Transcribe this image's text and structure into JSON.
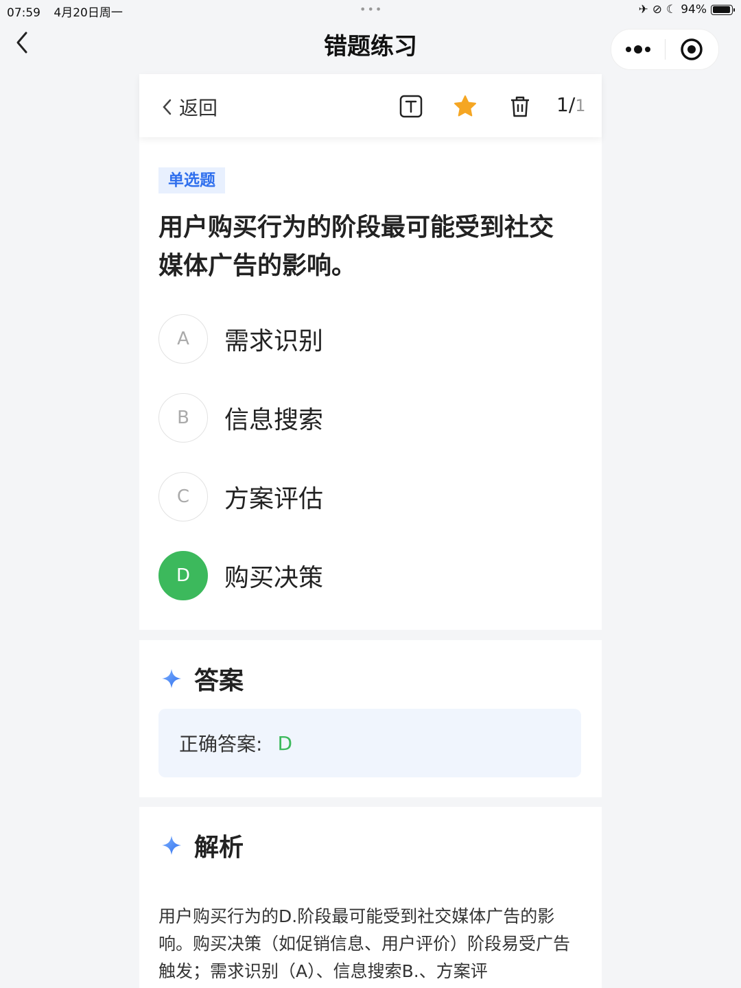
{
  "status": {
    "time": "07:59",
    "date": "4月20日周一",
    "battery": "94%",
    "battery_level": 0.94
  },
  "nav": {
    "title": "错题练习",
    "back_icon": "chevron-left-icon",
    "more_icon": "more-dots-icon",
    "close_icon": "record-circle-icon"
  },
  "toolbar": {
    "back_label": "返回",
    "text_icon": "text-icon",
    "favorite_icon": "star-icon",
    "favorite_color": "#f5a623",
    "delete_icon": "trash-icon",
    "current": "1/",
    "total": "1"
  },
  "question": {
    "type": "单选题",
    "text": "用户购买行为的阶段最可能受到社交媒体广告的影响。",
    "options": [
      {
        "letter": "A",
        "label": "需求识别",
        "correct": false
      },
      {
        "letter": "B",
        "label": "信息搜索",
        "correct": false
      },
      {
        "letter": "C",
        "label": "方案评估",
        "correct": false
      },
      {
        "letter": "D",
        "label": "购买决策",
        "correct": true
      }
    ],
    "correct_color": "#3cb95c"
  },
  "answer": {
    "title": "答案",
    "label": "正确答案:",
    "value": "D"
  },
  "analysis": {
    "title": "解析",
    "text": "用户购买行为的D.阶段最可能受到社交媒体广告的影响。购买决策（如促销信息、用户评价）阶段易受广告触发；需求识别（A）、信息搜索B.、方案评"
  }
}
